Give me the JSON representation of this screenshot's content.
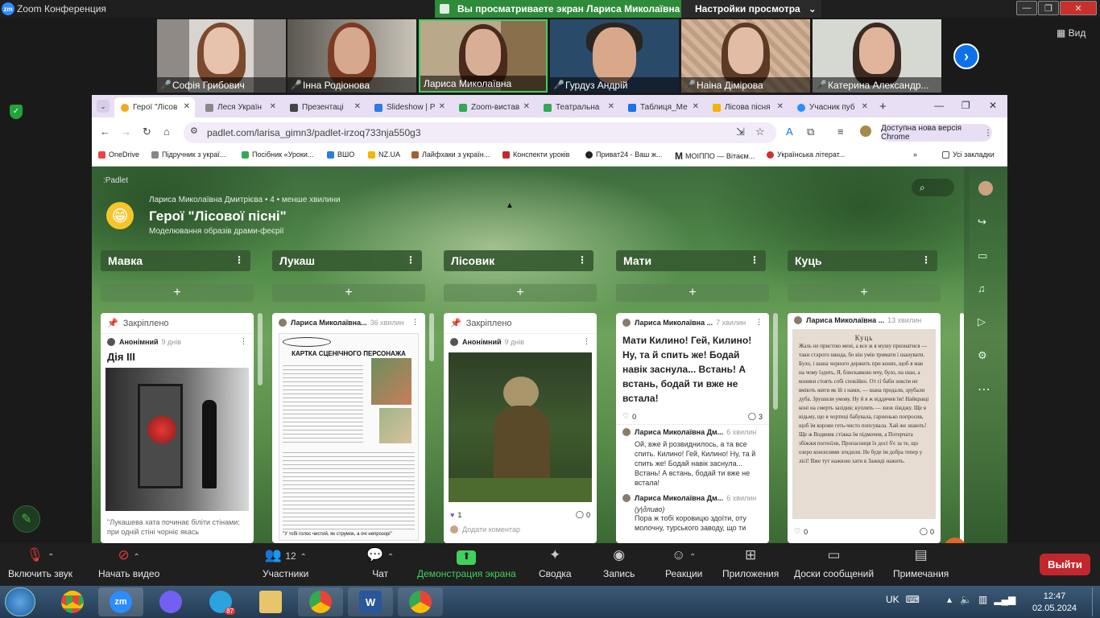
{
  "zoom": {
    "window_title": "Zoom Конференция",
    "share_banner": "Вы просматриваете экран Лариса Миколаївна",
    "view_settings": "Настройки просмотра",
    "view_button": "Вид",
    "participants": [
      {
        "name": "Софія Грибович"
      },
      {
        "name": "Інна Родіонова"
      },
      {
        "name": "Лариса Миколаївна"
      },
      {
        "name": "Гурдуз Андрій"
      },
      {
        "name": "Наіна Дімірова"
      },
      {
        "name": "Катерина Александр..."
      }
    ],
    "controls": {
      "unmute": "Включить звук",
      "start_video": "Начать видео",
      "participants": "Участники",
      "participants_count": "12",
      "chat": "Чат",
      "share": "Демонстрация экрана",
      "summary": "Сводка",
      "record": "Запись",
      "reactions": "Реакции",
      "apps": "Приложения",
      "whiteboards": "Доски сообщений",
      "notes": "Примечания",
      "leave": "Выйти"
    }
  },
  "browser": {
    "tabs": [
      {
        "label": "Герої \"Лісов",
        "active": true,
        "color": "#f5a623"
      },
      {
        "label": "Леся Україн",
        "active": false,
        "color": "#888888"
      },
      {
        "label": "Презентаці",
        "active": false,
        "color": "#444444"
      },
      {
        "label": "Slideshow | P",
        "active": false,
        "color": "#2d7be5"
      },
      {
        "label": "Zoom-вистав",
        "active": false,
        "color": "#34a853"
      },
      {
        "label": "Театральна",
        "active": false,
        "color": "#34a853"
      },
      {
        "label": "Таблиця_Ме",
        "active": false,
        "color": "#1a73e8"
      },
      {
        "label": "Лісова пісня",
        "active": false,
        "color": "#f4b400"
      },
      {
        "label": "Учасник пуб",
        "active": false,
        "color": "#2d8cff"
      }
    ],
    "url": "padlet.com/larisa_gimn3/padlet-irzoq733nja550g3",
    "update_button": "Доступна нова версія Chrome",
    "bookmarks": [
      {
        "label": "OneDrive"
      },
      {
        "label": "Підручник з украї..."
      },
      {
        "label": "Посібник «Уроки..."
      },
      {
        "label": "ВШО"
      },
      {
        "label": "NZ.UA"
      },
      {
        "label": "Лайфхаки з україн..."
      },
      {
        "label": "Конспекти уроків"
      },
      {
        "label": "Приват24 - Ваш ж..."
      },
      {
        "label": "МОІППО — Вітаєм..."
      },
      {
        "label": "Українська літерат..."
      }
    ],
    "all_bookmarks": "Усі закладки"
  },
  "padlet": {
    "logo": ":Padlet",
    "author_line": "Лариса Миколаївна Дмитрієва • 4 • менше хвилини",
    "title": "Герої \"Лісової пісні\"",
    "subtitle": "Моделювання образів драми-феєрії",
    "columns": [
      {
        "title": "Мавка"
      },
      {
        "title": "Лукаш"
      },
      {
        "title": "Лісовик"
      },
      {
        "title": "Мати"
      },
      {
        "title": "Куць"
      }
    ],
    "cards": {
      "mavka": {
        "pinned": "Закріплено",
        "author": "Анонімний",
        "time": "9 днів",
        "heading": "Дія III",
        "caption": "\"Лукашева хата починає біліти стінами; при одній стіні чорніє якась"
      },
      "lukash": {
        "author": "Лариса Миколаївна...",
        "time": "36 хвилин",
        "doc_title": "КАРТКА СЦЕНІЧНОГО ПЕРСОНАЖА",
        "doc_footer": "\"У тобі голос чистий, як струмок, а очі непрозорі\""
      },
      "lisovyk": {
        "pinned": "Закріплено",
        "author": "Анонімний",
        "time": "9 днів",
        "likes": "1",
        "comments": "0",
        "add_comment": "Додати коментар"
      },
      "maty": {
        "author": "Лариса Миколаївна ...",
        "time": "7 хвилин",
        "text": "Мати Килино! Гей, Килино! Ну, та й спить же! Бодай навік заснула... Встань! А встань, бодай ти вже не встала!",
        "likes": "0",
        "comments": "3",
        "comment1_author": "Лариса Миколаївна Дм...",
        "comment1_time": "6 хвилин",
        "comment1_text": "Ой, вже й розвиднилось, а та все спить. Килино! Гей, Килино! Ну, та й спить же! Бодай навік заснула... Встань! А встань, бодай ти вже не встала!",
        "comment2_author": "Лариса Миколаївна Дм...",
        "comment2_time": "6 хвилин",
        "comment2_note": "(у|дливо)",
        "comment2_text": "Пора ж тобі коровицю здоїти, оту молочну, турського заводу, що ти"
      },
      "kuts": {
        "author": "Лариса Миколаївна ...",
        "time": "13 хвилин",
        "page_title": "Куць",
        "page_text": "Жаль не пристою мені, а все ж я мушу признатися — таки старого шкода, бо він умів тримати і шанувати. Було, і шана чорного держить при конях, щоб я мав на чому їздить, Я, блискавкою мчу, було, на шан, а коники стоять собі спокійно. От сі баби зовсім не вміють жити як їй з нами, — шана продали, зрубали дуба. Зрушили умову. Ну й я ж віддячив їм! Найкращі коні на смерть зазідив; куплять — знов зїжджу. Ще я відьму, що в чортиці бабувала, гарненько попросив, щоб їм корови геть-чисто попсувала. Хай же знають! Ще ж Водяник стіжка їм підмочив, а Потерчата збіжжя погноїли, Пропасниця їх досі б'є за те, що озеро коноплями згидили. Не буде їм добра тепер у лісі! Вже тут нажною хати в Зажиді нажить.",
        "likes": "0",
        "comments": "0"
      }
    }
  },
  "taskbar": {
    "lang": "UK",
    "time": "12:47",
    "date": "02.05.2024",
    "telegram_badge": "87"
  }
}
